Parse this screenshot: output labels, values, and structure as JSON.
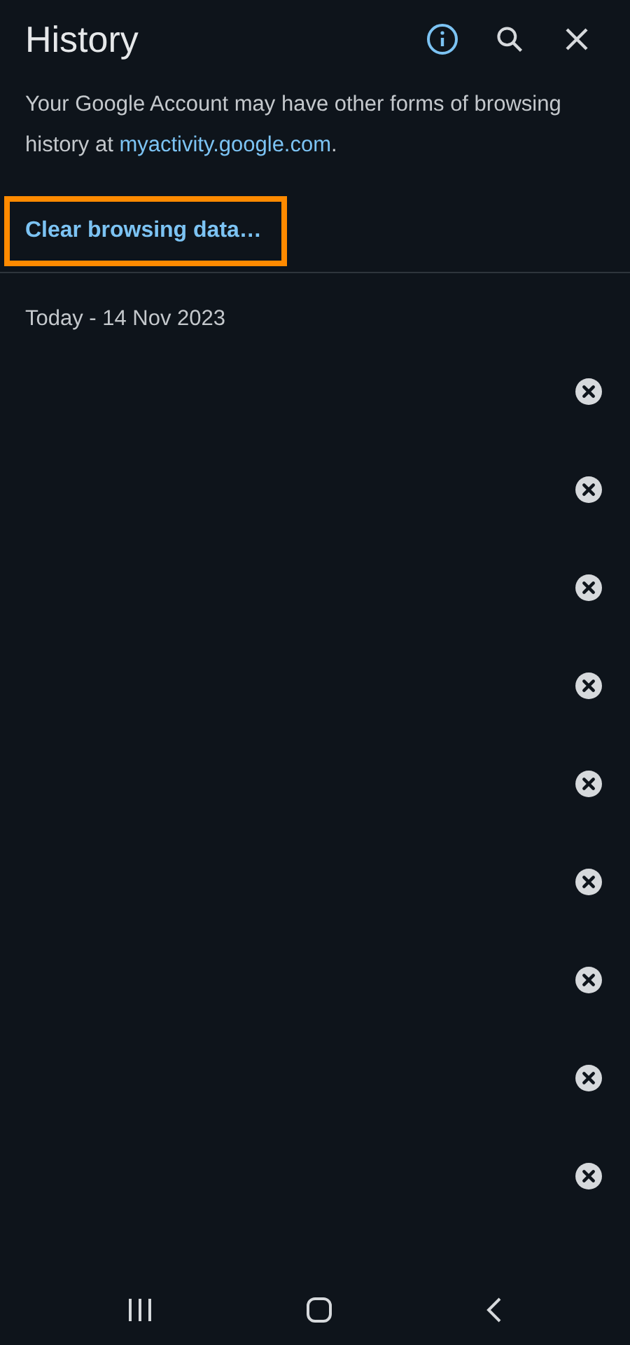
{
  "header": {
    "title": "History"
  },
  "notice": {
    "text": "Your Google Account may have other forms of browsing history at ",
    "link": "myactivity.google.com",
    "tail": "."
  },
  "clear_button": {
    "label": "Clear browsing data…",
    "highlighted": true
  },
  "date_heading": "Today - 14 Nov 2023",
  "entries": [
    {
      "kind": "blank"
    },
    {
      "kind": "blank"
    },
    {
      "kind": "blank"
    },
    {
      "kind": "blank"
    },
    {
      "kind": "blank"
    },
    {
      "kind": "blank"
    },
    {
      "kind": "blank"
    },
    {
      "kind": "blank"
    },
    {
      "kind": "blank"
    }
  ]
}
